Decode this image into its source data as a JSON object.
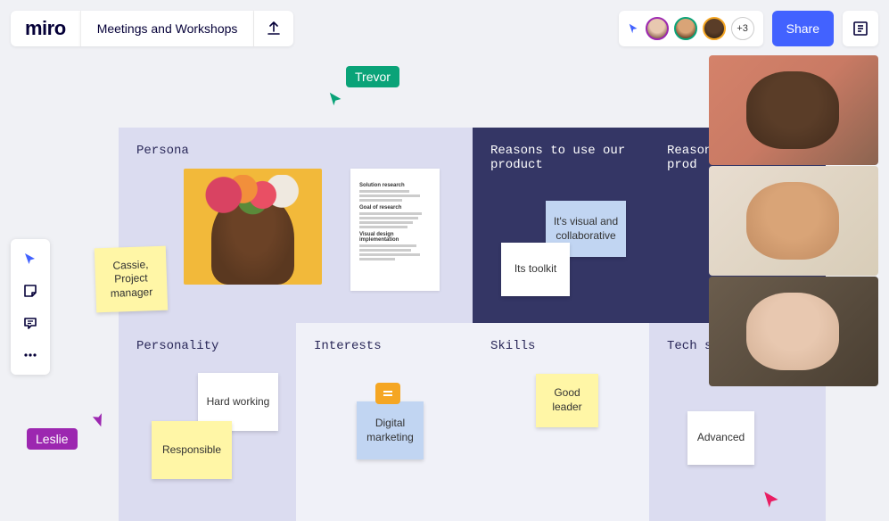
{
  "header": {
    "logo": "miro",
    "board_title": "Meetings and Workshops",
    "share": "Share",
    "avatar_more": "+3",
    "avatar_colors": [
      "#9c27b0",
      "#0aa378",
      "#f5a623"
    ]
  },
  "cursors": {
    "leslie": {
      "name": "Leslie",
      "color": "#9c27b0"
    },
    "trevor": {
      "name": "Trevor",
      "color": "#0aa378"
    }
  },
  "grid": {
    "persona": {
      "title": "Persona"
    },
    "reasons1": {
      "title": "Reasons to use our product"
    },
    "reasons2": {
      "title": "Reasons to use our prod"
    },
    "personality": {
      "title": "Personality"
    },
    "interests": {
      "title": "Interests"
    },
    "skills": {
      "title": "Skills"
    },
    "tech": {
      "title": "Tech sav"
    }
  },
  "stickies": {
    "cassie": "Cassie, Project manager",
    "visual": "It's visual and collaborative",
    "toolkit": "Its toolkit",
    "hardworking": "Hard working",
    "responsible": "Responsible",
    "digital": "Digital marketing",
    "goodleader": "Good leader",
    "advanced": "Advanced"
  },
  "doc": {
    "h1": "Solution research",
    "h2": "Goal of research",
    "h3": "Visual design implementation"
  },
  "icons": {
    "select": "select-cursor",
    "sticky": "sticky-note",
    "comment": "comment",
    "more": "more"
  }
}
